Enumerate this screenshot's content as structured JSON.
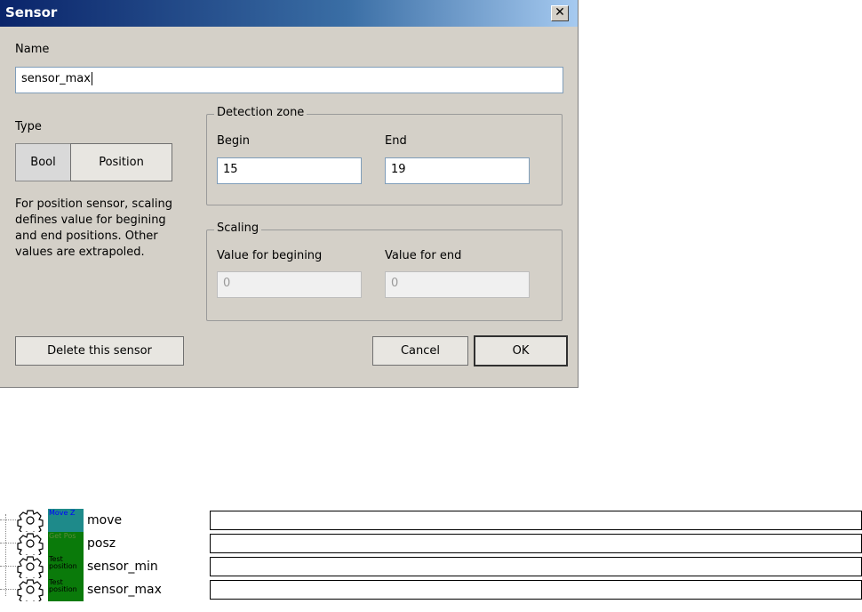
{
  "dialog": {
    "title": "Sensor",
    "close_label": "✕",
    "name_label": "Name",
    "name_value": "sensor_max",
    "type_label": "Type",
    "type_options": [
      "Bool",
      "Position"
    ],
    "help_text_lines": [
      "For position sensor, scaling",
      "defines value for begining",
      "and end positions. Other",
      "values are extrapoled."
    ],
    "detection": {
      "legend": "Detection zone",
      "begin_label": "Begin",
      "begin_value": "15",
      "end_label": "End",
      "end_value": "19"
    },
    "scaling": {
      "legend": "Scaling",
      "begin_label": "Value for begining",
      "begin_value": "0",
      "end_label": "Value for end",
      "end_value": "0"
    },
    "delete_label": "Delete this sensor",
    "cancel_label": "Cancel",
    "ok_label": "OK"
  },
  "tree": {
    "items": [
      {
        "name": "move",
        "badge": "Move Z",
        "badge_bg": "#1e8a8a",
        "badge_fg": "#0000ff"
      },
      {
        "name": "posz",
        "badge": "Get Pos",
        "badge_bg": "#0a7a0a",
        "badge_fg": "#5a8a3a"
      },
      {
        "name": "sensor_min",
        "badge": "Test position",
        "badge_bg": "#0a7a0a",
        "badge_fg": "#000000"
      },
      {
        "name": "sensor_max",
        "badge": "Test position",
        "badge_bg": "#0a7a0a",
        "badge_fg": "#000000"
      }
    ],
    "icon": "gear-icon"
  }
}
